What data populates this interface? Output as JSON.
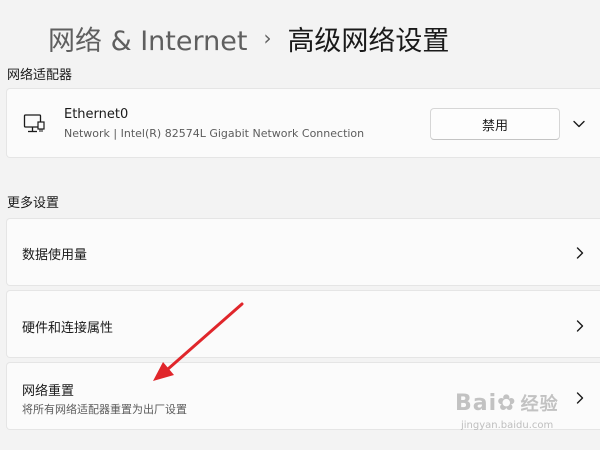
{
  "breadcrumb": {
    "parent": "网络 & Internet",
    "separator": "›",
    "current": "高级网络设置"
  },
  "adapters_section": {
    "title": "网络适配器",
    "adapter": {
      "name": "Ethernet0",
      "description": "Network | Intel(R) 82574L Gigabit Network Connection",
      "disable_label": "禁用"
    }
  },
  "more_section": {
    "title": "更多设置",
    "items": [
      {
        "label": "数据使用量"
      },
      {
        "label": "硬件和连接属性"
      },
      {
        "label": "网络重置",
        "sub": "将所有网络适配器重置为出厂设置"
      }
    ]
  },
  "watermark": {
    "brand": "Bai",
    "brand_cn": "经验",
    "url": "jingyan.baidu.com"
  },
  "colors": {
    "background": "#f3f3f3",
    "card": "#fbfbfb",
    "annotation_arrow": "#e0262b"
  },
  "icons": {
    "adapter": "ethernet-monitor-icon",
    "expand": "chevron-down-icon",
    "navigate": "chevron-right-icon"
  }
}
